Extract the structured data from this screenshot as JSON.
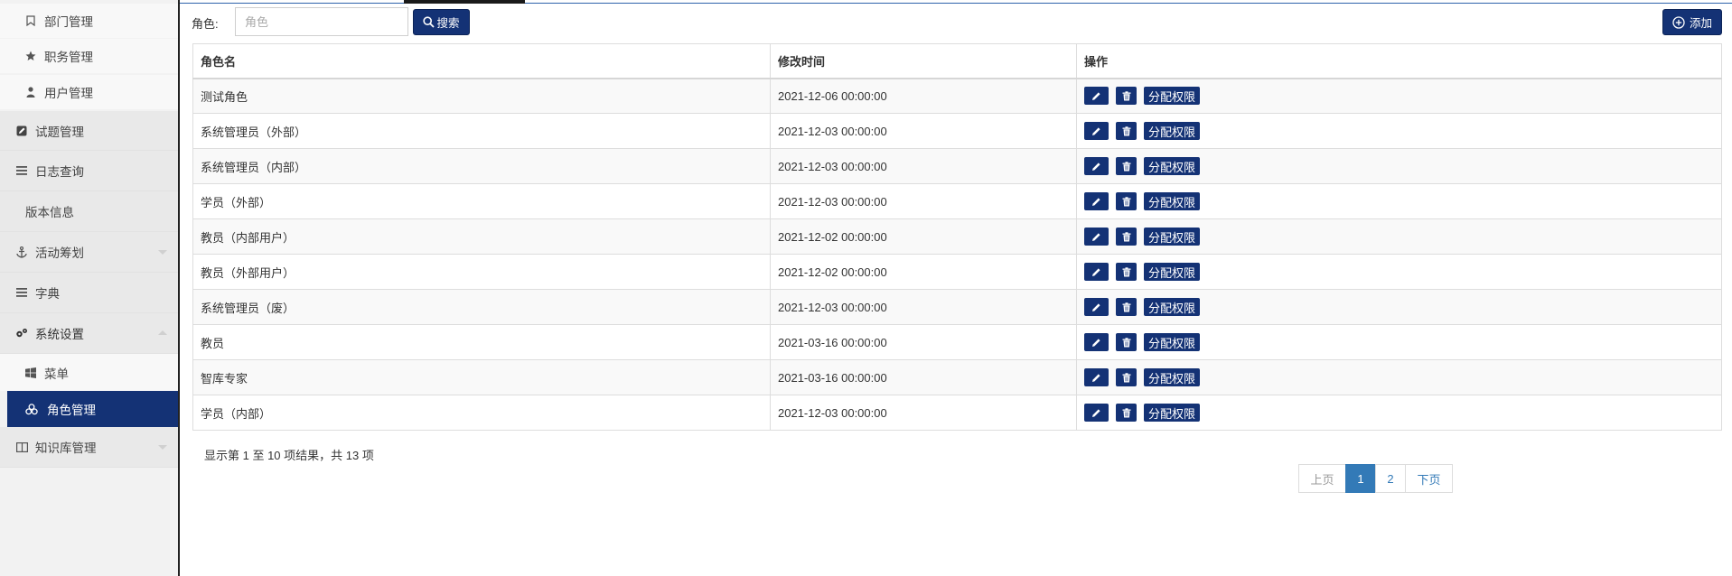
{
  "sidebar": {
    "items": [
      {
        "label": "部门管理",
        "icon": "bookmark-icon"
      },
      {
        "label": "职务管理",
        "icon": "star-icon"
      },
      {
        "label": "用户管理",
        "icon": "user-icon"
      },
      {
        "label": "试题管理",
        "icon": "edit-square-icon"
      },
      {
        "label": "日志查询",
        "icon": "list-icon"
      },
      {
        "label": "版本信息",
        "icon": ""
      },
      {
        "label": "活动筹划",
        "icon": "anchor-icon"
      },
      {
        "label": "字典",
        "icon": "list-icon"
      },
      {
        "label": "系统设置",
        "icon": "gears-icon"
      },
      {
        "label": "菜单",
        "icon": "windows-icon"
      },
      {
        "label": "角色管理",
        "icon": "cubes-icon"
      },
      {
        "label": "知识库管理",
        "icon": "book-columns-icon"
      }
    ],
    "active_color": "#143275"
  },
  "search": {
    "label": "角色:",
    "placeholder": "角色",
    "value": "",
    "button_label": "搜索"
  },
  "toolbar": {
    "add_label": "添加"
  },
  "table": {
    "headers": [
      "角色名",
      "修改时间",
      "操作"
    ],
    "assign_label": "分配权限",
    "rows": [
      {
        "name": "测试角色",
        "time": "2021-12-06 00:00:00"
      },
      {
        "name": "系统管理员（外部）",
        "time": "2021-12-03 00:00:00"
      },
      {
        "name": "系统管理员（内部）",
        "time": "2021-12-03 00:00:00"
      },
      {
        "name": "学员（外部）",
        "time": "2021-12-03 00:00:00"
      },
      {
        "name": "教员（内部用户）",
        "time": "2021-12-02 00:00:00"
      },
      {
        "name": "教员（外部用户）",
        "time": "2021-12-02 00:00:00"
      },
      {
        "name": "系统管理员（废）",
        "time": "2021-12-03 00:00:00"
      },
      {
        "name": "教员",
        "time": "2021-03-16 00:00:00"
      },
      {
        "name": "智库专家",
        "time": "2021-03-16 00:00:00"
      },
      {
        "name": "学员（内部）",
        "time": "2021-12-03 00:00:00"
      }
    ]
  },
  "footer": {
    "result_info": "显示第 1 至 10 项结果，共 13 项",
    "pagination": {
      "prev": "上页",
      "pages": [
        "1",
        "2"
      ],
      "current": "1",
      "next": "下页"
    }
  },
  "colors": {
    "primary": "#143275",
    "pager_active": "#337ab7"
  }
}
